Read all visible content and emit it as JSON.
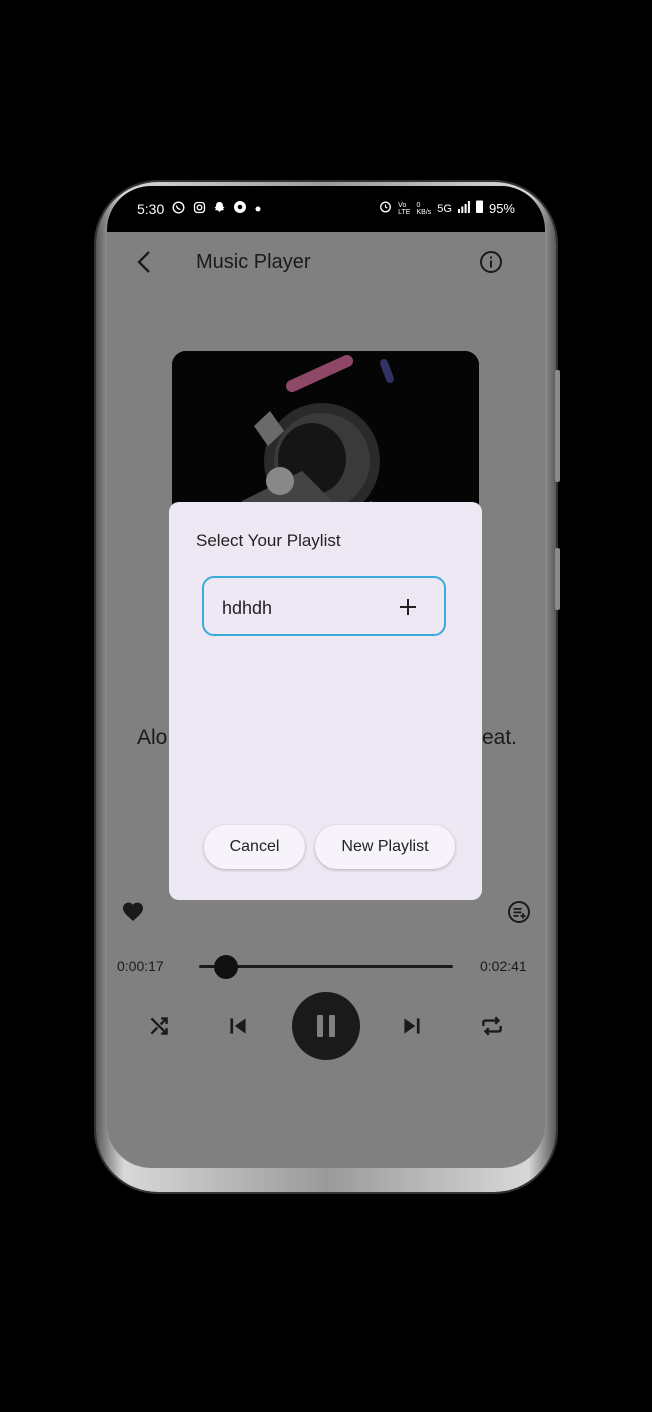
{
  "status_bar": {
    "time": "5:30",
    "left_icons": [
      "whatsapp-icon",
      "instagram-icon",
      "snapchat-icon",
      "settings-badge-icon",
      "dot-icon"
    ],
    "right_icons": [
      "alarm-icon",
      "volte-icon",
      "data-speed-icon",
      "signal-icon",
      "battery-icon"
    ],
    "network": "5G",
    "battery": "95%"
  },
  "app_bar": {
    "title": "Music Player",
    "back_icon": "chevron-left-icon",
    "info_icon": "info-circle-icon"
  },
  "player": {
    "song_title_left": "Alo",
    "song_title_right": "eat.",
    "elapsed": "0:00:17",
    "duration": "0:02:41",
    "progress": 0.105
  },
  "dialog": {
    "title": "Select Your Playlist",
    "playlist_item": "hdhdh",
    "cancel_label": "Cancel",
    "new_playlist_label": "New Playlist"
  },
  "colors": {
    "overlay": "#808080",
    "dialog_bg": "#ede8f4",
    "field_border": "#3aa9dc",
    "dark": "#1a1a1a"
  }
}
